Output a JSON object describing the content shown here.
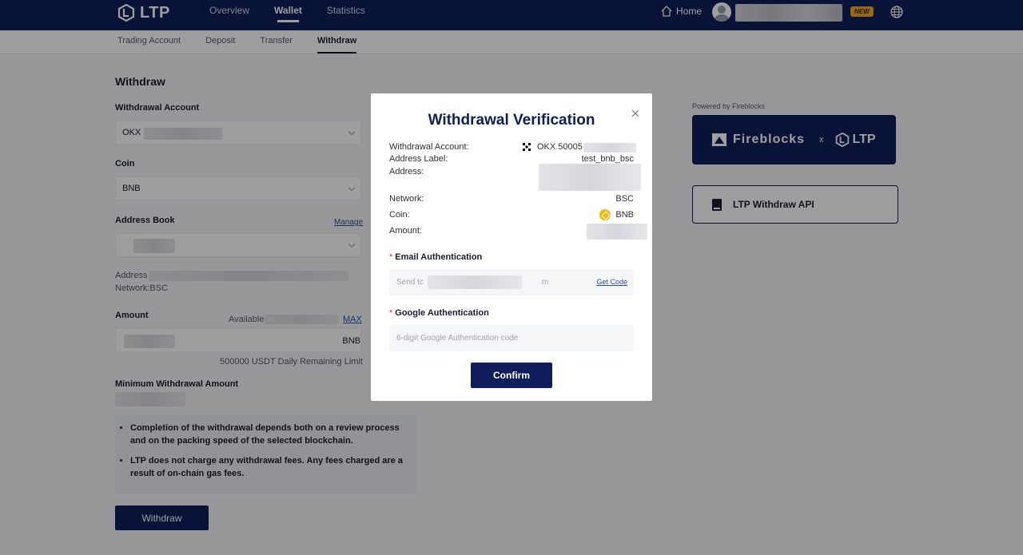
{
  "app": {
    "logo_text": "LTP"
  },
  "topnav": {
    "items": [
      "Overview",
      "Wallet",
      "Statistics"
    ],
    "home_label": "Home",
    "new_badge": "NEW"
  },
  "subnav": {
    "items": [
      "Trading Account",
      "Deposit",
      "Transfer",
      "Withdraw"
    ]
  },
  "form": {
    "title": "Withdraw",
    "account_label": "Withdrawal Account",
    "account_value": "OKX",
    "coin_label": "Coin",
    "coin_value": "BNB",
    "address_book_label": "Address Book",
    "manage_link": "Manage",
    "address_prefix": "Address",
    "network_text": "Network:BSC",
    "amount_label": "Amount",
    "available_label": "Available",
    "max_link": "MAX",
    "amount_unit": "BNB",
    "daily_limit": "500000 USDT Daily Remaining Limit",
    "min_label": "Minimum Withdrawal Amount",
    "notes": [
      "Completion of the withdrawal depends both on a review process and on the packing speed of the selected blockchain.",
      "LTP does not charge any withdrawal fees. Any fees charged are a result of on-chain gas fees."
    ],
    "withdraw_button": "Withdraw"
  },
  "right": {
    "powered_by": "Powered by Fireblocks",
    "fireblocks_text": "Fireblocks",
    "x_text": "x",
    "ltp_text": "LTP",
    "api_label": "LTP Withdraw API"
  },
  "modal": {
    "title": "Withdrawal Verification",
    "rows": {
      "account_label": "Withdrawal Account:",
      "account_value": "OKX 50005",
      "label_label": "Address Label:",
      "label_value": "test_bnb_bsc",
      "address_label": "Address:",
      "network_label": "Network:",
      "network_value": "BSC",
      "coin_label": "Coin:",
      "coin_value": "BNB",
      "amount_label": "Amount:"
    },
    "email_auth_label": "Email Authentication",
    "email_placeholder_start": "Send tc",
    "email_placeholder_end": "m",
    "get_code": "Get Code",
    "google_auth_label": "Google Authentication",
    "google_placeholder": "6-digit Google Authentication code",
    "confirm_button": "Confirm"
  },
  "colors": {
    "navy": "#0f1d5a",
    "link": "#2b4ea2",
    "required": "#e0303f",
    "badge": "#f5a623"
  }
}
